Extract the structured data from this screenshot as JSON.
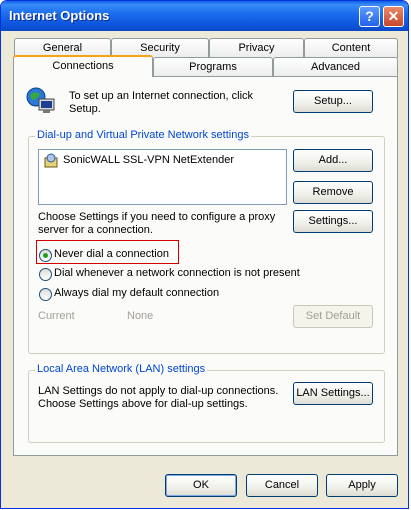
{
  "window": {
    "title": "Internet Options",
    "help_label": "?",
    "close_label": "✕"
  },
  "tabs": {
    "row1": [
      "General",
      "Security",
      "Privacy",
      "Content"
    ],
    "row2": [
      "Connections",
      "Programs",
      "Advanced"
    ],
    "active": "Connections"
  },
  "setup": {
    "text": [
      "To set up an Internet connection, click",
      "Setup."
    ],
    "button": "Setup..."
  },
  "dialup": {
    "legend": "Dial-up and Virtual Private Network settings",
    "list_items": [
      "SonicWALL SSL-VPN NetExtender"
    ],
    "add_button": "Add...",
    "remove_button": "Remove",
    "settings_text": [
      "Choose Settings if you need to configure a proxy",
      "server for a connection."
    ],
    "settings_button": "Settings...",
    "radios": [
      {
        "label": "Never dial a connection",
        "checked": true
      },
      {
        "label": "Dial whenever a network connection is not present",
        "checked": false
      },
      {
        "label": "Always dial my default connection",
        "checked": false
      }
    ],
    "current_label": "Current",
    "current_value": "None",
    "set_default_button": "Set Default"
  },
  "lan": {
    "legend": "Local Area Network (LAN) settings",
    "text": [
      "LAN Settings do not apply to dial-up connections.",
      "Choose Settings above for dial-up settings."
    ],
    "button": "LAN Settings..."
  },
  "footer": {
    "ok": "OK",
    "cancel": "Cancel",
    "apply": "Apply"
  },
  "colors": {
    "title_bar": "#0d55dc",
    "legend": "#0046d5",
    "highlight": "#d00000",
    "active_tab": "#f7a21b"
  }
}
